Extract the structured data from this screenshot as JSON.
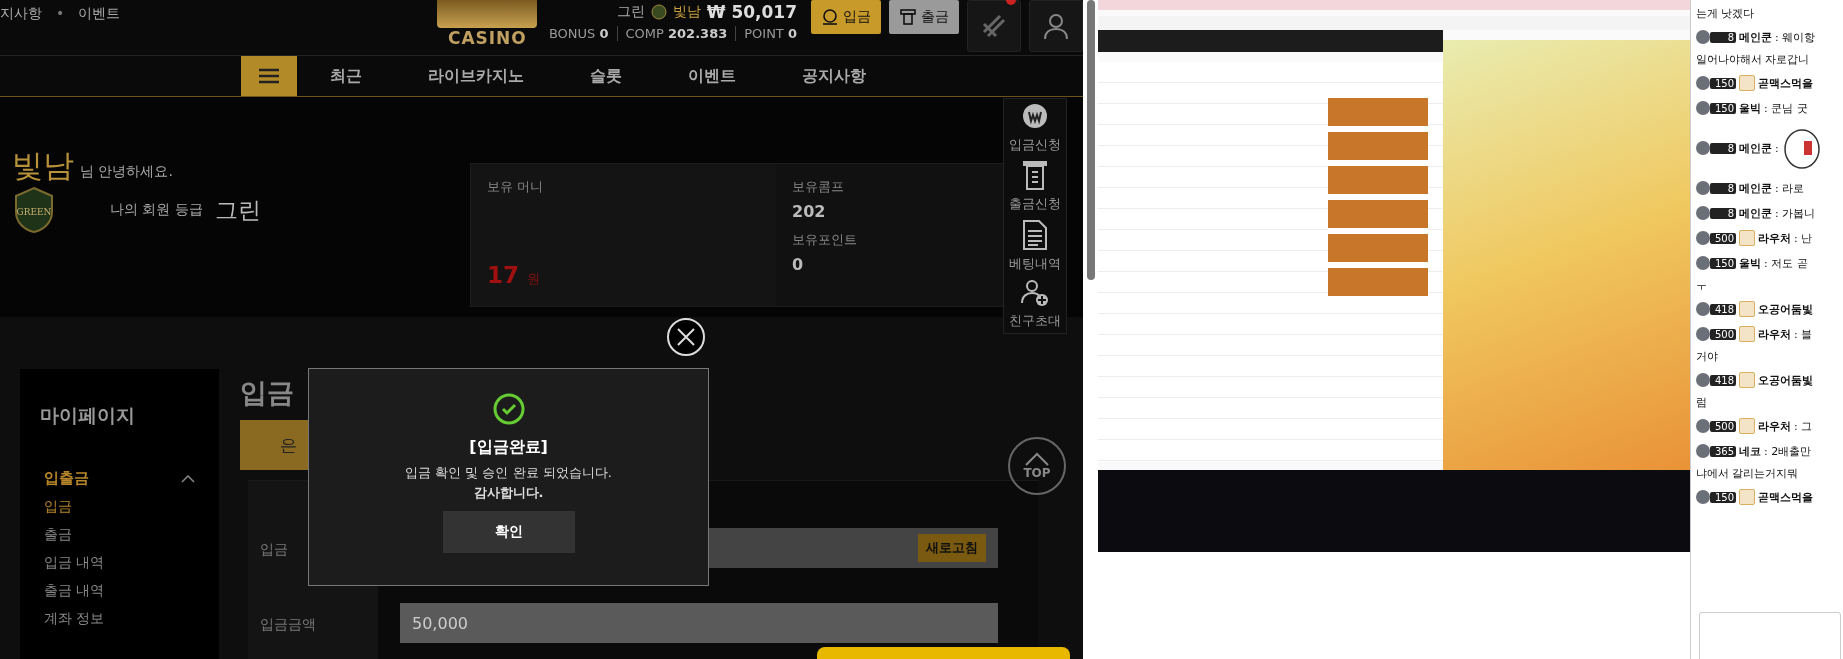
{
  "header": {
    "links": [
      "지사항",
      "이벤트"
    ],
    "separator": "•",
    "logo_caption": "CASINO",
    "grade": "그린",
    "nickname": "빛남",
    "balance": "₩ 50,017",
    "stats": [
      {
        "label": "BONUS",
        "value": "0"
      },
      {
        "label": "COMP",
        "value": "202.383"
      },
      {
        "label": "POINT",
        "value": "0"
      }
    ],
    "buttons": [
      {
        "label": "입금",
        "kind": "deposit"
      },
      {
        "label": "출금",
        "kind": "withdraw"
      }
    ]
  },
  "nav": {
    "items": [
      "최근",
      "라이브카지노",
      "슬롯",
      "이벤트",
      "공지사항"
    ]
  },
  "welcome": {
    "nickname": "빛남",
    "greeting": "님 안녕하세요.",
    "grade_label": "나의 회원 등급",
    "grade": "그린",
    "badge_text": "GREEN"
  },
  "balance": {
    "money_label": "보유 머니",
    "money": "17",
    "unit": "원",
    "comp_label": "보유콤프",
    "comp": "202",
    "point_label": "보유포인트",
    "point": "0"
  },
  "quick_menu": [
    {
      "label": "입금신청",
      "kind": "coin"
    },
    {
      "label": "출금신청",
      "kind": "atm"
    },
    {
      "label": "베팅내역",
      "kind": "document"
    },
    {
      "label": "친구초대",
      "kind": "invite"
    }
  ],
  "top_button": "TOP",
  "mypage": {
    "title": "마이페이지",
    "section": {
      "label": "입출금",
      "expanded": true
    },
    "items": [
      {
        "label": "입금",
        "selected": true
      },
      {
        "label": "출금",
        "selected": false
      },
      {
        "label": "입금 내역",
        "selected": false
      },
      {
        "label": "출금 내역",
        "selected": false
      },
      {
        "label": "계좌 정보",
        "selected": false
      }
    ]
  },
  "deposit_form": {
    "title": "입금",
    "tab": "은",
    "account_label": "입금",
    "refresh_button": "새로고침",
    "amount_label": "입금금액",
    "amount": "50,000"
  },
  "modal": {
    "title": "[입금완료]",
    "message": "입금 확인 및 승인 완료 되었습니다.",
    "message2": "감사합니다.",
    "confirm": "확인"
  },
  "chat": {
    "messages": [
      {
        "kind": "continuation",
        "text": "는게 낫겠다"
      },
      {
        "kind": "message",
        "badge": "8",
        "avatar": false,
        "name": "메인쿤",
        "text": ": 웨이항"
      },
      {
        "kind": "continuation",
        "text": "일어나야해서 자로갑니"
      },
      {
        "kind": "message",
        "badge": "150",
        "avatar": true,
        "name": "곧맥스먹을"
      },
      {
        "kind": "message",
        "badge": "150",
        "avatar": false,
        "name": "울빅",
        "text": ": 쿤님 굿"
      },
      {
        "kind": "sticker",
        "badge": "8",
        "avatar": false,
        "name": "메인쿤",
        "text": ":"
      },
      {
        "kind": "message",
        "badge": "8",
        "avatar": false,
        "name": "메인쿤",
        "text": ": 라로"
      },
      {
        "kind": "message",
        "badge": "8",
        "avatar": false,
        "name": "메인쿤",
        "text": ": 가봅니"
      },
      {
        "kind": "message",
        "badge": "500",
        "avatar": true,
        "name": "라우처",
        "text": ": 난"
      },
      {
        "kind": "message",
        "badge": "150",
        "avatar": false,
        "name": "울빅",
        "text": ": 저도 곧"
      },
      {
        "kind": "continuation",
        "text": "ㅜ"
      },
      {
        "kind": "message",
        "badge": "418",
        "avatar": true,
        "name": "오공어둠빛"
      },
      {
        "kind": "message",
        "badge": "500",
        "avatar": true,
        "name": "라우처",
        "text": ": 블"
      },
      {
        "kind": "continuation",
        "text": "거야"
      },
      {
        "kind": "message",
        "badge": "418",
        "avatar": true,
        "name": "오공어둠빛"
      },
      {
        "kind": "continuation",
        "text": "럼"
      },
      {
        "kind": "message",
        "badge": "500",
        "avatar": true,
        "name": "라우처",
        "text": ": 그"
      },
      {
        "kind": "message",
        "badge": "365",
        "avatar": false,
        "name": "네코",
        "text": ": 2배출만"
      },
      {
        "kind": "continuation",
        "text": "냐에서 갈리는거지뭐"
      },
      {
        "kind": "message",
        "badge": "150",
        "avatar": true,
        "name": "곧맥스먹을"
      }
    ]
  }
}
